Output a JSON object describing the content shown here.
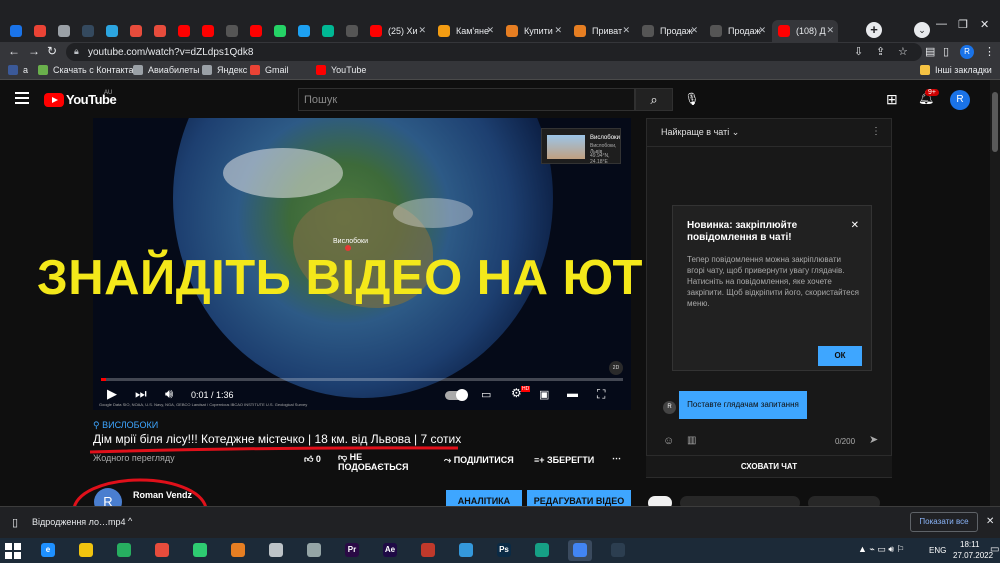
{
  "browser": {
    "tabs": [
      {
        "title": "",
        "color": "#1a73e8"
      },
      {
        "title": "",
        "color": "#ea4335"
      },
      {
        "title": "",
        "color": "#9aa0a6"
      },
      {
        "title": "",
        "color": "#34495e"
      },
      {
        "title": "",
        "color": "#2ca5e0"
      },
      {
        "title": "",
        "color": "#e74c3c"
      },
      {
        "title": "",
        "color": "#e74c3c"
      },
      {
        "title": "",
        "color": "#ff0000"
      },
      {
        "title": "",
        "color": "#ff0000"
      },
      {
        "title": "",
        "color": "#555"
      },
      {
        "title": "",
        "color": "#ff0000"
      },
      {
        "title": "",
        "color": "#25d366"
      },
      {
        "title": "",
        "color": "#1da1f2"
      },
      {
        "title": "",
        "color": "#00b894"
      },
      {
        "title": "",
        "color": "#555"
      },
      {
        "title": "(25) Хи",
        "color": "#ff0000"
      },
      {
        "title": "Кам'яне",
        "color": "#f39c12"
      },
      {
        "title": "Купити",
        "color": "#e67e22"
      },
      {
        "title": "Приват",
        "color": "#e67e22"
      },
      {
        "title": "Продаж",
        "color": "#555"
      },
      {
        "title": "Продаж",
        "color": "#555"
      },
      {
        "title": "(108) Д",
        "color": "#ff0000"
      }
    ],
    "new_tab": "+",
    "url": "youtube.com/watch?v=dZLdps1Qdk8",
    "profile_initial": "R",
    "bookmarks": [
      {
        "label": "a",
        "color": "#3b5998"
      },
      {
        "label": "Скачать с Контакта...",
        "color": "#6ab04c"
      },
      {
        "label": "Авиабилеты",
        "color": "#9aa0a6"
      },
      {
        "label": "Яндекс",
        "color": "#9aa0a6"
      },
      {
        "label": "Gmail",
        "color": "#ea4335"
      },
      {
        "label": "YouTube",
        "color": "#ff0000"
      }
    ],
    "other_bookmarks": "Інші закладки"
  },
  "youtube": {
    "logo_text": "YouTube",
    "region": "AU",
    "search_placeholder": "Пошук",
    "notif_count": "9+",
    "avatar_initial": "R",
    "player": {
      "place_title": "Вислобоки",
      "place_sub": "Вислобоки, Львів",
      "place_coords": "49.94°N, 24.18°E",
      "pin_label": "Вислобоки",
      "time": "0:01 / 1:36",
      "progress": 0.01,
      "badge": "2D",
      "hd": "HD",
      "credits": "Google  Data SIO, NOAA, U.S. Navy, NGA, GEBCO  Landsat / Copernicus  IBCAO  INSTITUTE  U.S. Geological Survey"
    },
    "overlay_text": "ЗНАЙДІТЬ ВІДЕО НА ЮТЮБІ",
    "location_tag": "ВИСЛОБОКИ",
    "title": "Дім мрії біля лісу!!! Котеджне містечко | 18 км. від Львова | 7 сотих",
    "views": "Жодного перегляду",
    "actions": {
      "likes": "0",
      "dislike": "НЕ ПОДОБАЄТЬСЯ",
      "share": "ПОДІЛИТИСЯ",
      "save": "ЗБЕРЕГТИ"
    },
    "channel": {
      "initial": "R",
      "name": "Roman Vendz"
    },
    "analytics_label": "АНАЛІТИКА",
    "edit_label": "РЕДАГУВАТИ ВІДЕО",
    "chat": {
      "header": "Найкраще в чаті",
      "popup_title": "Новинка: закріплюйте повідомлення в чаті!",
      "popup_body": "Тепер повідомлення можна закріплювати вгорі чату, щоб привернути увагу глядачів. Натисніть на повідомлення, яке хочете закріпити. Щоб відкріпити його, скористайтеся меню.",
      "ok_label": "ОК",
      "tooltip": "Поставте глядачам запитання",
      "avatar_initial": "R",
      "char_count": "0/200",
      "hide_label": "СХОВАТИ ЧАТ"
    }
  },
  "download_bar": {
    "file": "Відродження ло…mp4",
    "show_all": "Показати все"
  },
  "taskbar": {
    "apps": [
      {
        "glyph": "e",
        "color": "#1e90ff"
      },
      {
        "glyph": "",
        "color": "#f1c40f"
      },
      {
        "glyph": "",
        "color": "#27ae60"
      },
      {
        "glyph": "",
        "color": "#e74c3c"
      },
      {
        "glyph": "",
        "color": "#2ecc71"
      },
      {
        "glyph": "",
        "color": "#e67e22"
      },
      {
        "glyph": "",
        "color": "#bdc3c7"
      },
      {
        "glyph": "",
        "color": "#95a5a6"
      },
      {
        "glyph": "Pr",
        "color": "#2a0a45"
      },
      {
        "glyph": "Ae",
        "color": "#1f0a45"
      },
      {
        "glyph": "",
        "color": "#c0392b"
      },
      {
        "glyph": "",
        "color": "#3498db"
      },
      {
        "glyph": "Ps",
        "color": "#0a2a45"
      },
      {
        "glyph": "",
        "color": "#16a085"
      },
      {
        "glyph": "",
        "color": "#4285f4"
      },
      {
        "glyph": "",
        "color": "#2c3e50"
      }
    ],
    "lang": "ENG",
    "time": "18:11",
    "date": "27.07.2022"
  }
}
